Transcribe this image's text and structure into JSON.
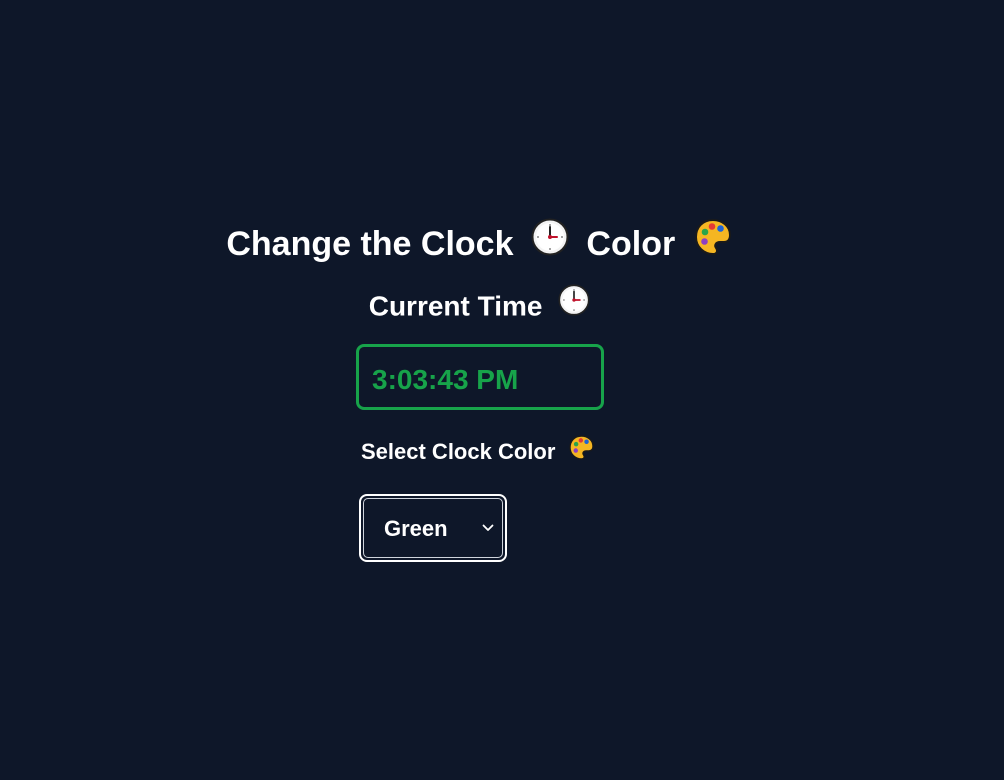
{
  "header": {
    "title_part1": "Change the Clock",
    "title_clock_emoji": "🕒",
    "title_part2": "Color",
    "title_palette_emoji": "🎨"
  },
  "clock": {
    "label": "Current Time",
    "label_emoji": "🕒",
    "time": "3:03:43 PM",
    "color": "#17a34a"
  },
  "color_select": {
    "label": "Select Clock Color",
    "label_emoji": "🎨",
    "selected": "Green"
  },
  "theme": {
    "background": "#0e1729",
    "text": "#ffffff",
    "accent": "#17a34a"
  }
}
